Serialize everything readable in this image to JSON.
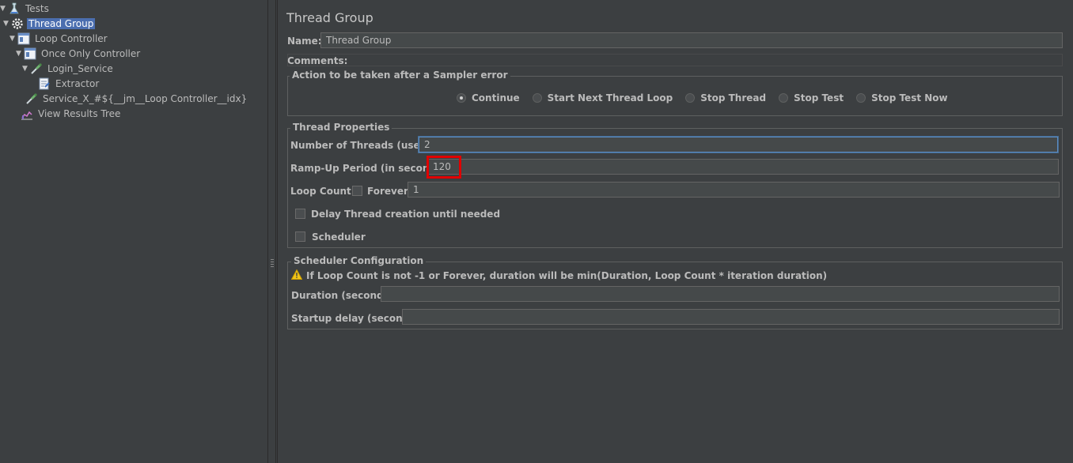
{
  "tree": {
    "items": [
      {
        "label": "Tests"
      },
      {
        "label": "Thread Group"
      },
      {
        "label": "Loop Controller"
      },
      {
        "label": "Once Only Controller"
      },
      {
        "label": "Login_Service"
      },
      {
        "label": "Extractor"
      },
      {
        "label": "Service_X_#${__jm__Loop Controller__idx}"
      },
      {
        "label": "View Results Tree"
      }
    ]
  },
  "editor": {
    "title": "Thread Group",
    "name_label": "Name:",
    "name_value": "Thread Group",
    "comments_label": "Comments:",
    "sampler_error": {
      "legend": "Action to be taken after a Sampler error",
      "options": [
        "Continue",
        "Start Next Thread Loop",
        "Stop Thread",
        "Stop Test",
        "Stop Test Now"
      ],
      "selected": "Continue"
    },
    "thread_props": {
      "legend": "Thread Properties",
      "threads_label": "Number of Threads (users):",
      "threads_value": "2",
      "rampup_label": "Ramp-Up Period (in seconds):",
      "rampup_value": "120",
      "loop_label": "Loop Count:",
      "forever_label": "Forever",
      "loop_value": "1",
      "delay_label": "Delay Thread creation until needed",
      "scheduler_label": "Scheduler"
    },
    "scheduler_config": {
      "legend": "Scheduler Configuration",
      "warning": "If Loop Count is not -1 or Forever, duration will be min(Duration, Loop Count * iteration duration)",
      "duration_label": "Duration (seconds)",
      "startup_label": "Startup delay (seconds)"
    }
  },
  "colors": {
    "background": "#3c3f41",
    "selection": "#4b6eaf",
    "highlight": "#e00000"
  }
}
